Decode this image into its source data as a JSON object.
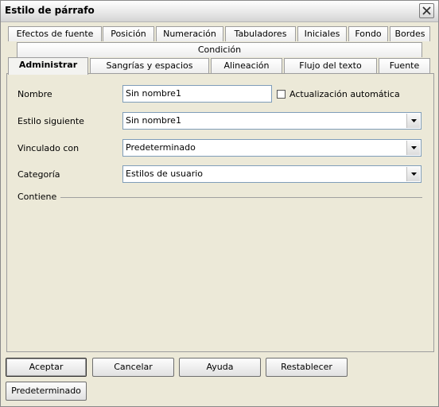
{
  "window": {
    "title": "Estilo de párrafo"
  },
  "tabs_row1": [
    "Efectos de fuente",
    "Posición",
    "Numeración",
    "Tabuladores",
    "Iniciales",
    "Fondo",
    "Bordes"
  ],
  "tabs_row2": [
    "Condición"
  ],
  "tabs_row3": [
    "Administrar",
    "Sangrías y espacios",
    "Alineación",
    "Flujo del texto",
    "Fuente"
  ],
  "active_tab": "Administrar",
  "form": {
    "name_label": "Nombre",
    "name_value": "Sin nombre1",
    "autoupdate_label": "Actualización automática",
    "autoupdate_checked": false,
    "next_label": "Estilo siguiente",
    "next_value": "Sin nombre1",
    "linked_label": "Vinculado con",
    "linked_value": "Predeterminado",
    "category_label": "Categoría",
    "category_value": "Estilos de usuario",
    "contains_label": "Contiene"
  },
  "buttons": {
    "ok": "Aceptar",
    "cancel": "Cancelar",
    "help": "Ayuda",
    "reset": "Restablecer",
    "default": "Predeterminado"
  }
}
